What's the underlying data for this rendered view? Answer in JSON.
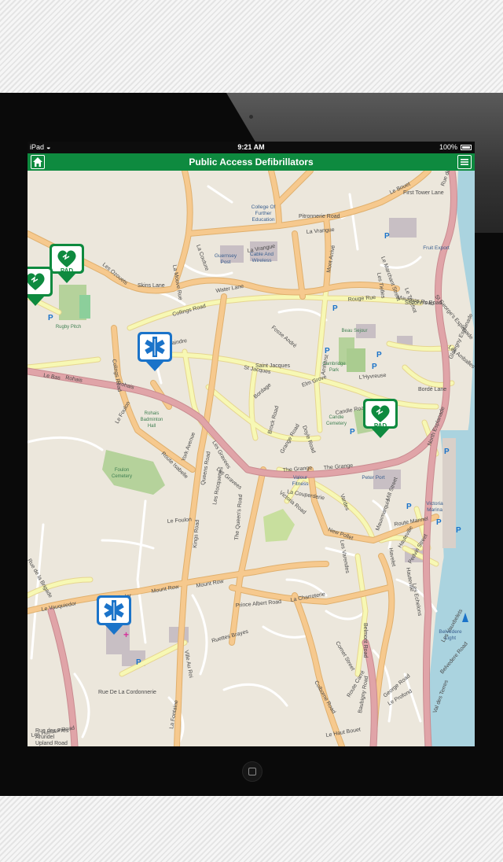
{
  "status_bar": {
    "device": "iPad",
    "time": "9:21 AM",
    "battery": "100%"
  },
  "app_bar": {
    "title": "Public Access Defibrillators",
    "home_icon": "home-icon",
    "menu_icon": "menu-icon"
  },
  "map": {
    "markers": [
      {
        "type": "pad",
        "label": "PAD",
        "color": "#0e8a3f"
      },
      {
        "type": "pad-partial",
        "label": "",
        "color": "#0e8a3f"
      },
      {
        "type": "pad",
        "label": "PAD",
        "color": "#0e8a3f"
      },
      {
        "type": "ambulance",
        "label": "",
        "color": "#1a73c9"
      },
      {
        "type": "ambulance",
        "label": "",
        "color": "#1a73c9"
      }
    ],
    "road_labels": [
      "Le Bouet",
      "First Tower Lane",
      "Pitronnerie Road",
      "La Vrangue",
      "La Vrangue",
      "La Couture",
      "Les Ozouets",
      "Skins Lane",
      "La Mouve Rue",
      "Water Lane",
      "Collings Road",
      "Vaindre",
      "Colings Road",
      "Le Bas",
      "Rohais",
      "Rohais",
      "Le Foulon",
      "Route Isabelle",
      "York Avenue",
      "Les Gravees",
      "Les Gravees",
      "The Grange",
      "The Grange",
      "Mount Row",
      "Mount Row",
      "Le Vauquiedor",
      "Le Vauquiedor",
      "Prince Albert Road",
      "La Charroterie",
      "Victoria Road",
      "Amherst",
      "Mont Arrivé",
      "Queens Road",
      "Kings Road",
      "The Queen's Road",
      "Vardes",
      "Les Varendes",
      "Mauxmarquis",
      "Route Mannel",
      "Pedvin Street",
      "Hauteville",
      "Les Echelons",
      "Candie Road",
      "Grange Road",
      "Elm Grove",
      "St Jacques",
      "Doyle Road",
      "Brock Road",
      "Fosse André",
      "Bordage",
      "New Pollet",
      "La Couperderie",
      "Mill Street",
      "Rouge Rue",
      "Mauripas Road",
      "St George's Esplanade",
      "Glategny Esplanade",
      "North Esplanade",
      "Belvedere Road",
      "Bordé Lane",
      "L'Hyvreuse",
      "Les Amballes",
      "Cornet Street",
      "Hauteville",
      "St John's Road",
      "Le Marchant Street",
      "Ruettes Brayes",
      "La Fontaine",
      "Ville Au Roi",
      "Les Rocquettes",
      "Rue De La Cordonnerie",
      "Les Huriaux Road",
      "Rue de la Brigade",
      "Saint Jacques",
      "Colborne Road",
      "Havelet",
      "Le Foulon",
      "Belmont Road",
      "George Road",
      "Les Vauxbelets",
      "Le Profond",
      "Val des Terres",
      "Rue de Beauvoir",
      "Les Tielles",
      "Le Truchot",
      "Route Carré",
      "Le Haut Bouet",
      "Baubigny Road",
      "Rue des Prés",
      "Arundel",
      "Upland Road"
    ],
    "place_labels": [
      "College Of Further Education",
      "Guernsey Post",
      "Cable And Wireless",
      "Beau Sejour",
      "Cambridge Park",
      "Candie Cemetery",
      "Rohais Badminton Hall",
      "Foulon Cemetery",
      "Rugby Pitch",
      "Valour Fitness",
      "Peter Port",
      "Victoria Marina",
      "Belvedere Light",
      "Fruit Export"
    ],
    "colors": {
      "land": "#ece7dc",
      "sea": "#aad3df",
      "minor_road": "#ffffff",
      "secondary_road": "#f7f8b4",
      "primary_road": "#f6c98e",
      "trunk_road": "#d89ca1",
      "park": "#b5d29b",
      "building": "#c8bfc4",
      "parking": "#1a73c9"
    }
  }
}
